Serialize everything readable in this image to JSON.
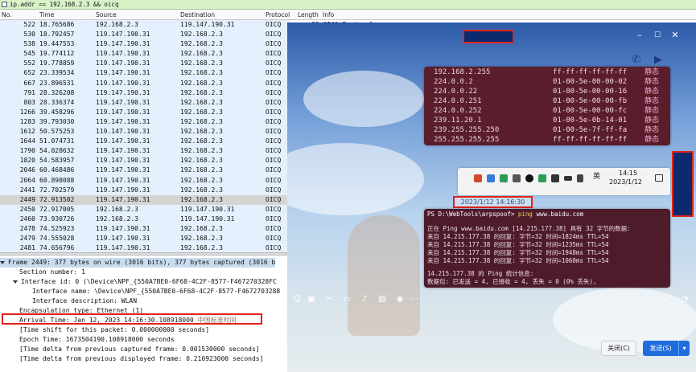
{
  "filter": {
    "text": "ip.addr == 192.168.2.3 && oicq"
  },
  "columns": {
    "no": "No.",
    "time": "Time",
    "source": "Source",
    "destination": "Destination",
    "protocol": "Protocol",
    "length": "Length",
    "info": "Info"
  },
  "packets": [
    {
      "no": "522",
      "time": "18.765686",
      "src": "192.168.2.3",
      "dst": "119.147.190.31",
      "proto": "OICQ"
    },
    {
      "no": "530",
      "time": "18.792457",
      "src": "119.147.190.31",
      "dst": "192.168.2.3",
      "proto": "OICQ"
    },
    {
      "no": "538",
      "time": "19.447553",
      "src": "119.147.190.31",
      "dst": "192.168.2.3",
      "proto": "OICQ"
    },
    {
      "no": "545",
      "time": "19.774112",
      "src": "119.147.190.31",
      "dst": "192.168.2.3",
      "proto": "OICQ"
    },
    {
      "no": "552",
      "time": "19.778859",
      "src": "119.147.190.31",
      "dst": "192.168.2.3",
      "proto": "OICQ"
    },
    {
      "no": "652",
      "time": "23.339534",
      "src": "119.147.190.31",
      "dst": "192.168.2.3",
      "proto": "OICQ"
    },
    {
      "no": "667",
      "time": "23.896531",
      "src": "119.147.190.31",
      "dst": "192.168.2.3",
      "proto": "OICQ"
    },
    {
      "no": "791",
      "time": "28.326208",
      "src": "119.147.190.31",
      "dst": "192.168.2.3",
      "proto": "OICQ"
    },
    {
      "no": "803",
      "time": "28.336374",
      "src": "119.147.190.31",
      "dst": "192.168.2.3",
      "proto": "OICQ"
    },
    {
      "no": "1266",
      "time": "39.458296",
      "src": "119.147.190.31",
      "dst": "192.168.2.3",
      "proto": "OICQ"
    },
    {
      "no": "1283",
      "time": "39.793030",
      "src": "119.147.190.31",
      "dst": "192.168.2.3",
      "proto": "OICQ"
    },
    {
      "no": "1612",
      "time": "50.575253",
      "src": "119.147.190.31",
      "dst": "192.168.2.3",
      "proto": "OICQ"
    },
    {
      "no": "1644",
      "time": "51.074731",
      "src": "119.147.190.31",
      "dst": "192.168.2.3",
      "proto": "OICQ"
    },
    {
      "no": "1790",
      "time": "54.028632",
      "src": "119.147.190.31",
      "dst": "192.168.2.3",
      "proto": "OICQ"
    },
    {
      "no": "1820",
      "time": "54.583957",
      "src": "119.147.190.31",
      "dst": "192.168.2.3",
      "proto": "OICQ"
    },
    {
      "no": "2046",
      "time": "60.468486",
      "src": "119.147.190.31",
      "dst": "192.168.2.3",
      "proto": "OICQ"
    },
    {
      "no": "2064",
      "time": "60.898088",
      "src": "119.147.190.31",
      "dst": "192.168.2.3",
      "proto": "OICQ"
    },
    {
      "no": "2441",
      "time": "72.702579",
      "src": "119.147.190.31",
      "dst": "192.168.2.3",
      "proto": "OICQ"
    },
    {
      "no": "2449",
      "time": "72.913502",
      "src": "119.147.190.31",
      "dst": "192.168.2.3",
      "proto": "OICQ",
      "selected": true
    },
    {
      "no": "2450",
      "time": "72.917005",
      "src": "192.168.2.3",
      "dst": "119.147.190.31",
      "proto": "OICQ"
    },
    {
      "no": "2460",
      "time": "73.930726",
      "src": "192.168.2.3",
      "dst": "119.147.190.31",
      "proto": "OICQ"
    },
    {
      "no": "2478",
      "time": "74.525923",
      "src": "119.147.190.31",
      "dst": "192.168.2.3",
      "proto": "OICQ"
    },
    {
      "no": "2479",
      "time": "74.555028",
      "src": "119.147.190.31",
      "dst": "192.168.2.3",
      "proto": "OICQ"
    },
    {
      "no": "2481",
      "time": "74.656796",
      "src": "119.147.190.31",
      "dst": "192.168.2.3",
      "proto": "OICQ"
    }
  ],
  "info_fragment": "81 OICQ Protocol",
  "detail": {
    "frame": "Frame 2449: 377 bytes on wire (3016 bits), 377 bytes captured (3016 b",
    "section": "Section number: 1",
    "interface": "Interface id: 0 (\\Device\\NPF_{550A7BE0-6F68-4C2F-8577-F467270328FC",
    "interface_name": "Interface name: \\Device\\NPF_{550A7BE0-6F68-4C2F-8577-F4672703288",
    "interface_desc": "Interface description: WLAN",
    "encap": "Encapsulation type: Ethernet (1)",
    "arrival": "Arrival Time: Jan 12, 2023 14:16:30.108918000",
    "arrival_tz": "中国标准时间",
    "shift": "[Time shift for this packet: 0.000000000 seconds]",
    "epoch": "Epoch Time: 1673504190.108918000 seconds",
    "delta_captured": "[Time delta from previous captured frame: 0.001530000 seconds]",
    "delta_displayed": "[Time delta from previous displayed frame: 0.210923000 seconds]"
  },
  "arp_table": [
    {
      "ip": "192.168.2.255",
      "mac": "ff-ff-ff-ff-ff-ff",
      "type": "静态"
    },
    {
      "ip": "224.0.0.2",
      "mac": "01-00-5e-00-00-02",
      "type": "静态"
    },
    {
      "ip": "224.0.0.22",
      "mac": "01-00-5e-00-00-16",
      "type": "静态"
    },
    {
      "ip": "224.0.0.251",
      "mac": "01-00-5e-00-00-fb",
      "type": "静态"
    },
    {
      "ip": "224.0.0.252",
      "mac": "01-00-5e-00-00-fc",
      "type": "静态"
    },
    {
      "ip": "239.11.20.1",
      "mac": "01-00-5e-0b-14-01",
      "type": "静态"
    },
    {
      "ip": "239.255.255.250",
      "mac": "01-00-5e-7f-ff-fa",
      "type": "静态"
    },
    {
      "ip": "255.255.255.255",
      "mac": "ff-ff-ff-ff-ff-ff",
      "type": "静态"
    }
  ],
  "taskbar": {
    "lang": "英",
    "time": "14:15",
    "date": "2023/1/12"
  },
  "chat_timestamp": "2023/1/12 14:16:30",
  "ping": {
    "prompt": "PS D:\\WebTools\\arpspoof>",
    "cmd": "ping",
    "arg": "www.baidu.com",
    "lines": [
      "正在 Ping www.baidu.com [14.215.177.38] 具有 32 字节的数据:",
      "来自 14.215.177.38 的回复: 字节=32 时间=1824ms TTL=54",
      "来自 14.215.177.38 的回复: 字节=32 时间=1235ms TTL=54",
      "来自 14.215.177.38 的回复: 字节=32 时间=1948ms TTL=54",
      "来自 14.215.177.38 的回复: 字节=32 时间=1060ms TTL=54",
      "",
      "14.215.177.38 的 Ping 统计信息:",
      "    数据包: 已发送 = 4, 已接收 = 4, 丢失 = 0 (0% 丢失),"
    ]
  },
  "buttons": {
    "close": "关闭(C)",
    "send": "发送(S)"
  }
}
